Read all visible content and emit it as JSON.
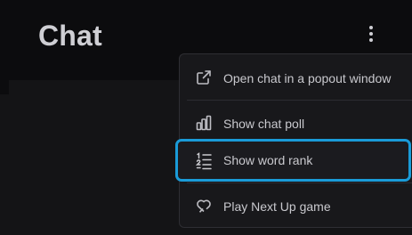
{
  "header": {
    "title": "Chat",
    "more_icon": "more-vertical-icon"
  },
  "menu": {
    "items": [
      {
        "label": "Open chat in a popout window",
        "icon": "external-link-icon"
      },
      {
        "label": "Show chat poll",
        "icon": "bar-chart-icon"
      },
      {
        "label": "Show word rank",
        "icon": "ranked-list-icon",
        "highlighted": true
      },
      {
        "label": "Play Next Up game",
        "icon": "heart-chat-icon"
      }
    ]
  },
  "colors": {
    "background": "#141416",
    "header_background": "#0c0c0e",
    "menu_background": "#18181b",
    "highlight_border": "#1a9bd8",
    "text": "#c9c9ce"
  }
}
